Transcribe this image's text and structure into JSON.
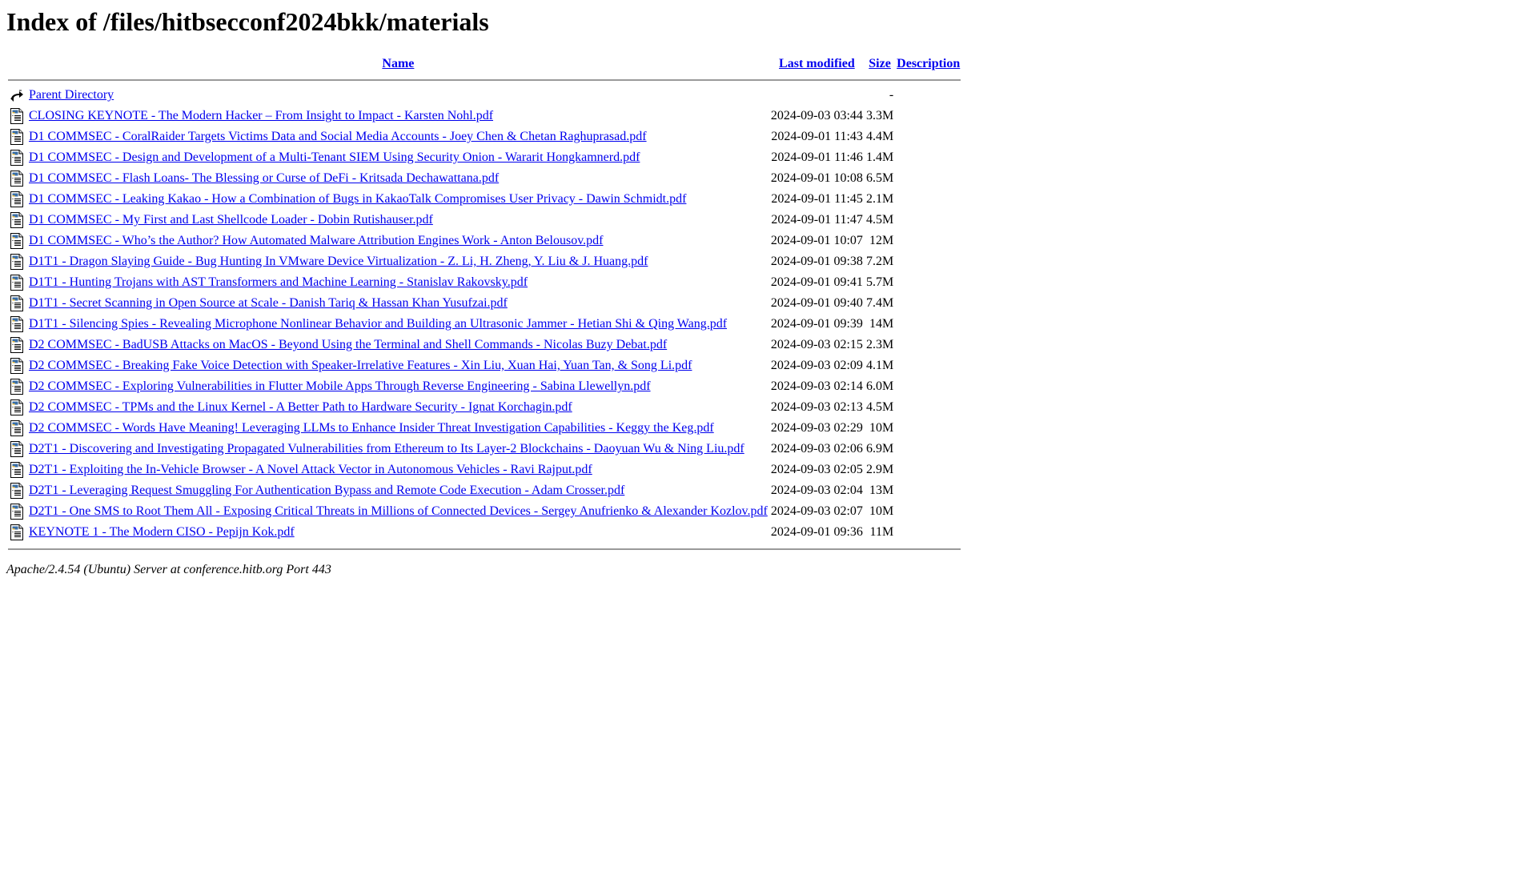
{
  "title": "Index of /files/hitbsecconf2024bkk/materials",
  "columns": {
    "name": "Name",
    "last_modified": "Last modified",
    "size": "Size",
    "description": "Description"
  },
  "parent": {
    "icon": "back-arrow-icon",
    "label": "Parent Directory",
    "last_modified": "",
    "size": "-",
    "description": ""
  },
  "files": [
    {
      "icon": "text-document-icon",
      "name": "CLOSING KEYNOTE - The Modern Hacker – From Insight to Impact - Karsten Nohl.pdf",
      "last_modified": "2024-09-03 03:44",
      "size": "3.3M",
      "description": ""
    },
    {
      "icon": "text-document-icon",
      "name": "D1 COMMSEC - CoralRaider Targets Victims Data and Social Media Accounts - Joey Chen & Chetan Raghuprasad.pdf",
      "last_modified": "2024-09-01 11:43",
      "size": "4.4M",
      "description": ""
    },
    {
      "icon": "text-document-icon",
      "name": "D1 COMMSEC - Design and Development of a Multi-Tenant SIEM Using Security Onion - Wararit Hongkamnerd.pdf",
      "last_modified": "2024-09-01 11:46",
      "size": "1.4M",
      "description": ""
    },
    {
      "icon": "text-document-icon",
      "name": "D1 COMMSEC - Flash Loans- The Blessing or Curse of DeFi - Kritsada Dechawattana.pdf",
      "last_modified": "2024-09-01 10:08",
      "size": "6.5M",
      "description": ""
    },
    {
      "icon": "text-document-icon",
      "name": "D1 COMMSEC - Leaking Kakao - How a Combination of Bugs in KakaoTalk Compromises User Privacy - Dawin Schmidt.pdf",
      "last_modified": "2024-09-01 11:45",
      "size": "2.1M",
      "description": ""
    },
    {
      "icon": "text-document-icon",
      "name": "D1 COMMSEC - My First and Last Shellcode Loader - Dobin Rutishauser.pdf",
      "last_modified": "2024-09-01 11:47",
      "size": "4.5M",
      "description": ""
    },
    {
      "icon": "text-document-icon",
      "name": "D1 COMMSEC - Who’s the Author? How Automated Malware Attribution Engines Work - Anton Belousov.pdf",
      "last_modified": "2024-09-01 10:07",
      "size": "12M",
      "description": ""
    },
    {
      "icon": "text-document-icon",
      "name": "D1T1 - Dragon Slaying Guide - Bug Hunting In VMware Device Virtualization - Z. Li, H. Zheng, Y. Liu & J. Huang.pdf",
      "last_modified": "2024-09-01 09:38",
      "size": "7.2M",
      "description": ""
    },
    {
      "icon": "text-document-icon",
      "name": "D1T1 - Hunting Trojans with AST Transformers and Machine Learning - Stanislav Rakovsky.pdf",
      "last_modified": "2024-09-01 09:41",
      "size": "5.7M",
      "description": ""
    },
    {
      "icon": "text-document-icon",
      "name": "D1T1 - Secret Scanning in Open Source at Scale - Danish Tariq & Hassan Khan Yusufzai.pdf",
      "last_modified": "2024-09-01 09:40",
      "size": "7.4M",
      "description": ""
    },
    {
      "icon": "text-document-icon",
      "name": "D1T1 - Silencing Spies - Revealing Microphone Nonlinear Behavior and Building an Ultrasonic Jammer - Hetian Shi & Qing Wang.pdf",
      "last_modified": "2024-09-01 09:39",
      "size": "14M",
      "description": ""
    },
    {
      "icon": "text-document-icon",
      "name": "D2 COMMSEC - BadUSB Attacks on MacOS - Beyond Using the Terminal and Shell Commands - Nicolas Buzy Debat.pdf",
      "last_modified": "2024-09-03 02:15",
      "size": "2.3M",
      "description": ""
    },
    {
      "icon": "text-document-icon",
      "name": "D2 COMMSEC - Breaking Fake Voice Detection with Speaker-Irrelative Features - Xin Liu, Xuan Hai, Yuan Tan, & Song Li.pdf",
      "last_modified": "2024-09-03 02:09",
      "size": "4.1M",
      "description": ""
    },
    {
      "icon": "text-document-icon",
      "name": "D2 COMMSEC - Exploring Vulnerabilities in Flutter Mobile Apps Through Reverse Engineering - Sabina Llewellyn.pdf",
      "last_modified": "2024-09-03 02:14",
      "size": "6.0M",
      "description": ""
    },
    {
      "icon": "text-document-icon",
      "name": "D2 COMMSEC - TPMs and the Linux Kernel - A Better Path to Hardware Security - Ignat Korchagin.pdf",
      "last_modified": "2024-09-03 02:13",
      "size": "4.5M",
      "description": ""
    },
    {
      "icon": "text-document-icon",
      "name": "D2 COMMSEC - Words Have Meaning! Leveraging LLMs to Enhance Insider Threat Investigation Capabilities - Keggy the Keg.pdf",
      "last_modified": "2024-09-03 02:29",
      "size": "10M",
      "description": ""
    },
    {
      "icon": "text-document-icon",
      "name": "D2T1 - Discovering and Investigating Propagated Vulnerabilities from Ethereum to Its Layer-2 Blockchains - Daoyuan Wu & Ning Liu.pdf",
      "last_modified": "2024-09-03 02:06",
      "size": "6.9M",
      "description": ""
    },
    {
      "icon": "text-document-icon",
      "name": "D2T1 - Exploiting the In-Vehicle Browser - A Novel Attack Vector in Autonomous Vehicles - Ravi Rajput.pdf",
      "last_modified": "2024-09-03 02:05",
      "size": "2.9M",
      "description": ""
    },
    {
      "icon": "text-document-icon",
      "name": "D2T1 - Leveraging Request Smuggling For Authentication Bypass and Remote Code Execution - Adam Crosser.pdf",
      "last_modified": "2024-09-03 02:04",
      "size": "13M",
      "description": ""
    },
    {
      "icon": "text-document-icon",
      "name": "D2T1 - One SMS to Root Them All - Exposing Critical Threats in Millions of Connected Devices - Sergey Anufrienko & Alexander Kozlov.pdf",
      "last_modified": "2024-09-03 02:07",
      "size": "10M",
      "description": ""
    },
    {
      "icon": "text-document-icon",
      "name": "KEYNOTE 1 - The Modern CISO - Pepijn Kok.pdf",
      "last_modified": "2024-09-01 09:36",
      "size": "11M",
      "description": ""
    }
  ],
  "footer": "Apache/2.4.54 (Ubuntu) Server at conference.hitb.org Port 443",
  "colors": {
    "link": "#0000ee",
    "text": "#000000",
    "rule": "#9a9a9a",
    "background": "#ffffff"
  }
}
